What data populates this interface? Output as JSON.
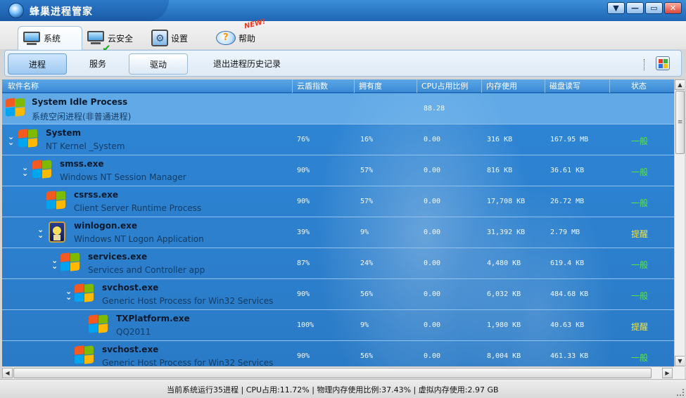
{
  "app": {
    "title": "蜂巢进程管家",
    "window_buttons": [
      "▼",
      "—",
      "▭",
      "✕"
    ]
  },
  "topnav": {
    "items": [
      {
        "label": "系统",
        "icon": "monitor-icon"
      },
      {
        "label": "云安全",
        "icon": "cloud-security-icon"
      },
      {
        "label": "设置",
        "icon": "settings-icon"
      },
      {
        "label": "帮助",
        "icon": "help-icon",
        "badge": "NEW!"
      }
    ]
  },
  "subnav": {
    "process": "进程",
    "service": "服务",
    "driver": "驱动",
    "exit_history": "退出进程历史记录"
  },
  "columns": {
    "name": "软件名称",
    "cloud": "云盾指数",
    "ownership": "拥有度",
    "cpu": "CPU占用比例",
    "memory": "内存使用",
    "disk": "磁盘读写",
    "status": "状态"
  },
  "colors": {
    "normal": "#58e83a",
    "warn": "#f2e23a",
    "list_bg": "#2e86d6"
  },
  "processes": [
    {
      "name": "System Idle Process",
      "desc": "系统空闲进程(非普通进程)",
      "cloud": "",
      "ownership": "",
      "cpu": "88.28",
      "memory": "",
      "disk": "",
      "status": "",
      "status_type": "normal"
    },
    {
      "name": "System",
      "desc": "NT Kernel _System",
      "cloud": "76%",
      "ownership": "16%",
      "cpu": "0.00",
      "memory": "316 KB",
      "disk": "167.95 MB",
      "status": "一般",
      "status_type": "normal"
    },
    {
      "name": "smss.exe",
      "desc": "Windows NT Session Manager",
      "cloud": "90%",
      "ownership": "57%",
      "cpu": "0.00",
      "memory": "816 KB",
      "disk": "36.61 KB",
      "status": "一般",
      "status_type": "normal"
    },
    {
      "name": "csrss.exe",
      "desc": "Client Server Runtime Process",
      "cloud": "90%",
      "ownership": "57%",
      "cpu": "0.00",
      "memory": "17,708 KB",
      "disk": "26.72 MB",
      "status": "一般",
      "status_type": "normal"
    },
    {
      "name": "winlogon.exe",
      "desc": "Windows NT Logon Application",
      "cloud": "39%",
      "ownership": "9%",
      "cpu": "0.00",
      "memory": "31,392 KB",
      "disk": "2.79 MB",
      "status": "提醒",
      "status_type": "warn"
    },
    {
      "name": "services.exe",
      "desc": "Services and Controller app",
      "cloud": "87%",
      "ownership": "24%",
      "cpu": "0.00",
      "memory": "4,480 KB",
      "disk": "619.4 KB",
      "status": "一般",
      "status_type": "normal"
    },
    {
      "name": "svchost.exe",
      "desc": "Generic Host Process for Win32 Services",
      "cloud": "90%",
      "ownership": "56%",
      "cpu": "0.00",
      "memory": "6,032 KB",
      "disk": "484.68 KB",
      "status": "一般",
      "status_type": "normal"
    },
    {
      "name": "TXPlatform.exe",
      "desc": "QQ2011",
      "cloud": "100%",
      "ownership": "9%",
      "cpu": "0.00",
      "memory": "1,980 KB",
      "disk": "40.63 KB",
      "status": "提醒",
      "status_type": "warn"
    },
    {
      "name": "svchost.exe",
      "desc": "Generic Host Process for Win32 Services",
      "cloud": "90%",
      "ownership": "56%",
      "cpu": "0.00",
      "memory": "8,004 KB",
      "disk": "461.33 KB",
      "status": "一般",
      "status_type": "normal"
    }
  ],
  "statusbar": {
    "text": "当前系统运行35进程 | CPU占用:11.72% | 物理内存使用比例:37.43% | 虚拟内存使用:2.97 GB"
  }
}
